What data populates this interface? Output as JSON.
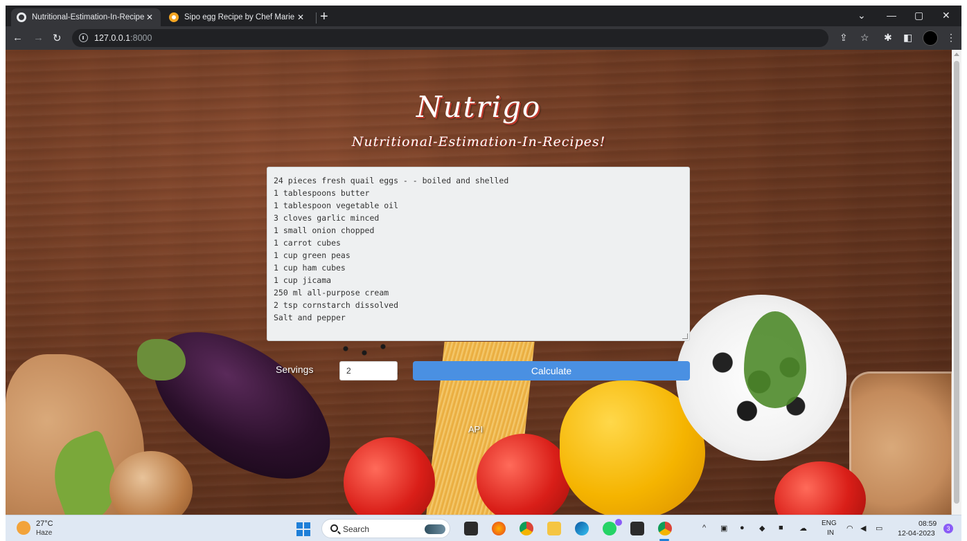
{
  "browser": {
    "tabs": [
      {
        "title": "Nutritional-Estimation-In-Recipe",
        "active": true,
        "icon": "globe-icon"
      },
      {
        "title": "Sipo egg Recipe by Chef Marie R",
        "active": false,
        "icon": "recipe-site-icon"
      }
    ],
    "close_glyph": "✕",
    "new_tab_glyph": "+",
    "url_host": "127.0.0.1",
    "url_port": ":8000",
    "window_controls": {
      "dropdown": "⌄",
      "minimize": "—",
      "maximize": "▢",
      "close": "✕"
    }
  },
  "page": {
    "title": "Nutrigo",
    "subtitle": "Nutritional-Estimation-In-Recipes!",
    "recipe_lines": [
      "24 pieces fresh quail eggs - - boiled and shelled",
      "1 tablespoons butter",
      "1 tablespoon vegetable oil",
      "3 cloves garlic minced",
      "1 small onion chopped",
      "1 carrot cubes",
      "1 cup green peas",
      "1 cup ham cubes",
      "1 cup jicama",
      "250 ml all-purpose cream",
      "2 tsp cornstarch dissolved",
      "Salt and pepper"
    ],
    "servings_label": "Servings",
    "servings_value": "2",
    "calculate_label": "Calculate",
    "api_link": "API",
    "colors": {
      "button": "#4a90e2",
      "title_shadow": "#c0392b"
    }
  },
  "taskbar": {
    "weather_temp": "27°C",
    "weather_desc": "Haze",
    "search_label": "Search",
    "whatsapp_badge": "1",
    "lang_top": "ENG",
    "lang_bottom": "IN",
    "time": "08:59",
    "date": "12-04-2023",
    "notifications": "3"
  }
}
